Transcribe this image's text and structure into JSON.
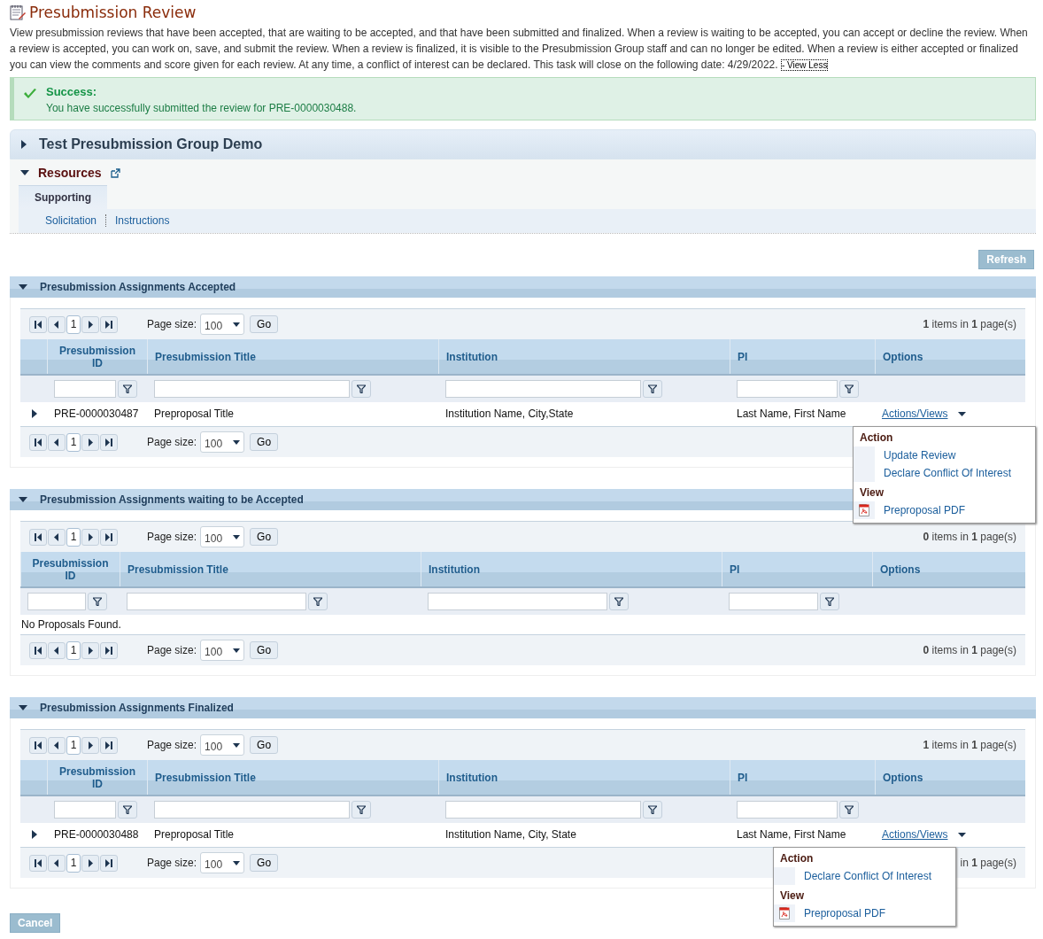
{
  "page": {
    "title": "Presubmission Review",
    "description": "View presubmission reviews that have been accepted, that are waiting to be accepted, and that have been submitted and finalized. When a review is waiting to be accepted, you can accept or decline the review. When a review is accepted, you can work on, save, and submit the review. When a review is finalized, it is visible to the Presubmission Group staff and can no longer be edited. When a review is either accepted or finalized you can view the comments and score given for each review. At any time, a conflict of interest can be declared. This task will close on the following date: 4/29/2022.",
    "view_less": "- View Less"
  },
  "alert": {
    "title": "Success:",
    "message": "You have successfully submitted the review for PRE-0000030488."
  },
  "group": {
    "title": "Test Presubmission Group Demo",
    "expanded": false
  },
  "resources": {
    "title": "Resources",
    "expanded": true,
    "tabs": [
      {
        "label": "Supporting",
        "selected": true
      }
    ],
    "links": [
      "Solicitation",
      "Instructions"
    ]
  },
  "refresh": "Refresh",
  "sections": [
    {
      "title": "Presubmission Assignments Accepted",
      "expanded": true,
      "top_pager": {
        "page": "1",
        "size_label": "Page size:",
        "size": "100",
        "go": "Go",
        "info": "**1** items in **1** page(s)"
      },
      "columns": [
        "Presubmission ID",
        "Presubmission Title",
        "Institution",
        "PI",
        "Options"
      ],
      "rows": [
        {
          "cells": [
            "PRE-0000030487",
            "Preproposal Title",
            "Institution Name, City,State",
            "Last Name, First Name"
          ],
          "link": "Actions/Views",
          "menu": [
            {
              "heading": "Action",
              "items": [
                {
                  "label": "Update Review",
                  "kind": "plain"
                },
                {
                  "label": "Declare Conflict Of Interest",
                  "kind": "plain"
                }
              ]
            },
            {
              "heading": "View",
              "items": [
                {
                  "label": "Preproposal PDF",
                  "kind": "pdf"
                }
              ]
            }
          ]
        }
      ],
      "bottom_pager": {
        "page": "1",
        "size_label": "Page size:",
        "size": "100",
        "go": "Go"
      }
    },
    {
      "title": "Presubmission Assignments waiting to be Accepted",
      "expanded": true,
      "top_pager": {
        "page": "1",
        "size_label": "Page size:",
        "size": "100",
        "go": "Go",
        "info": "**0** items in **1** page(s)"
      },
      "columns": [
        "Presubmission ID",
        "Presubmission Title",
        "Institution",
        "PI",
        "Options"
      ],
      "empty": "No Proposals Found.",
      "bottom_pager": {
        "page": "1",
        "size_label": "Page size:",
        "size": "100",
        "go": "Go",
        "info": "**0** items in **1** page(s)"
      }
    },
    {
      "title": "Presubmission Assignments Finalized",
      "expanded": true,
      "top_pager": {
        "page": "1",
        "size_label": "Page size:",
        "size": "100",
        "go": "Go",
        "info": "**1** items in **1** page(s)"
      },
      "columns": [
        "Presubmission ID",
        "Presubmission Title",
        "Institution",
        "PI",
        "Options"
      ],
      "rows": [
        {
          "cells": [
            "PRE-0000030488",
            "Preproposal Title",
            "Institution Name, City, State",
            "Last Name, First Name"
          ],
          "link": "Actions/Views",
          "menu": [
            {
              "heading": "Action",
              "items": [
                {
                  "label": "Declare Conflict Of Interest",
                  "kind": "plain"
                }
              ]
            },
            {
              "heading": "View",
              "items": [
                {
                  "label": "Preproposal PDF",
                  "kind": "pdf"
                }
              ]
            }
          ]
        }
      ],
      "bottom_pager": {
        "page": "1",
        "size_label": "Page size:",
        "size": "100",
        "go": "Go",
        "info": "in **1** page(s)"
      }
    }
  ],
  "cancel": "Cancel"
}
